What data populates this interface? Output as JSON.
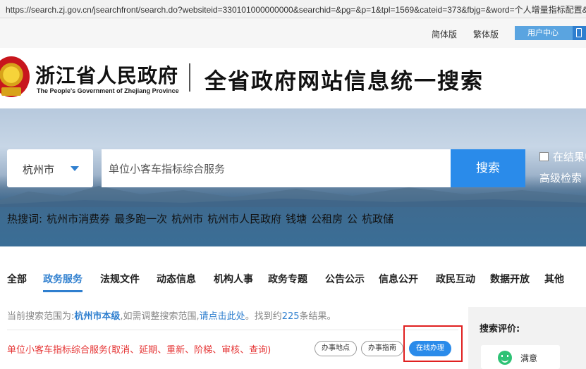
{
  "browser": {
    "url": "https://search.zj.gov.cn/jsearchfront/search.do?websiteid=330101000000000&searchid=&pg=&p=1&tpl=1569&cateid=373&fbjg=&word=个人增量指标配置&temporaryQ=&synonyms=&checkError=1&isContains=1&q=单位小客车指标综合服务"
  },
  "topnav": {
    "simplified": "简体版",
    "traditional": "繁体版",
    "user_center": "用户中心"
  },
  "header": {
    "logo_cn": "浙江省人民政府",
    "logo_en": "The People's Government of Zhejiang Province",
    "slogan": "全省政府网站信息统一搜索"
  },
  "search": {
    "city": "杭州市",
    "query": "单位小客车指标综合服务",
    "button": "搜索",
    "in_results": "在结果中",
    "advanced": "高级检索"
  },
  "hot": {
    "label": "热搜词:",
    "terms": [
      "杭州市消费券",
      "最多跑一次",
      "杭州市",
      "杭州市人民政府",
      "钱塘",
      "公租房",
      "公",
      "杭政储"
    ]
  },
  "tabs": [
    "全部",
    "政务服务",
    "法规文件",
    "动态信息",
    "机构人事",
    "政务专题",
    "公告公示",
    "信息公开",
    "政民互动",
    "数据开放",
    "其他"
  ],
  "active_tab": "政务服务",
  "scope": {
    "prefix": "当前搜索范围为:",
    "level": "杭州市本级",
    "mid": ",如需调整搜索范围,",
    "link": "请点击此处",
    "found": "。找到约",
    "count": "225",
    "suffix": "条结果。"
  },
  "result": {
    "title": "单位小客车指标综合服务(取消、延期、重新、阶梯、审核、查询)",
    "btn_location": "办事地点",
    "btn_guide": "办事指南",
    "btn_online": "在线办理"
  },
  "sidebar": {
    "rating_title": "搜索评价:",
    "satisfied": "满意"
  },
  "colors": {
    "accent": "#2a8bea",
    "result_red": "#e53333",
    "highlight_box": "#e02020"
  }
}
